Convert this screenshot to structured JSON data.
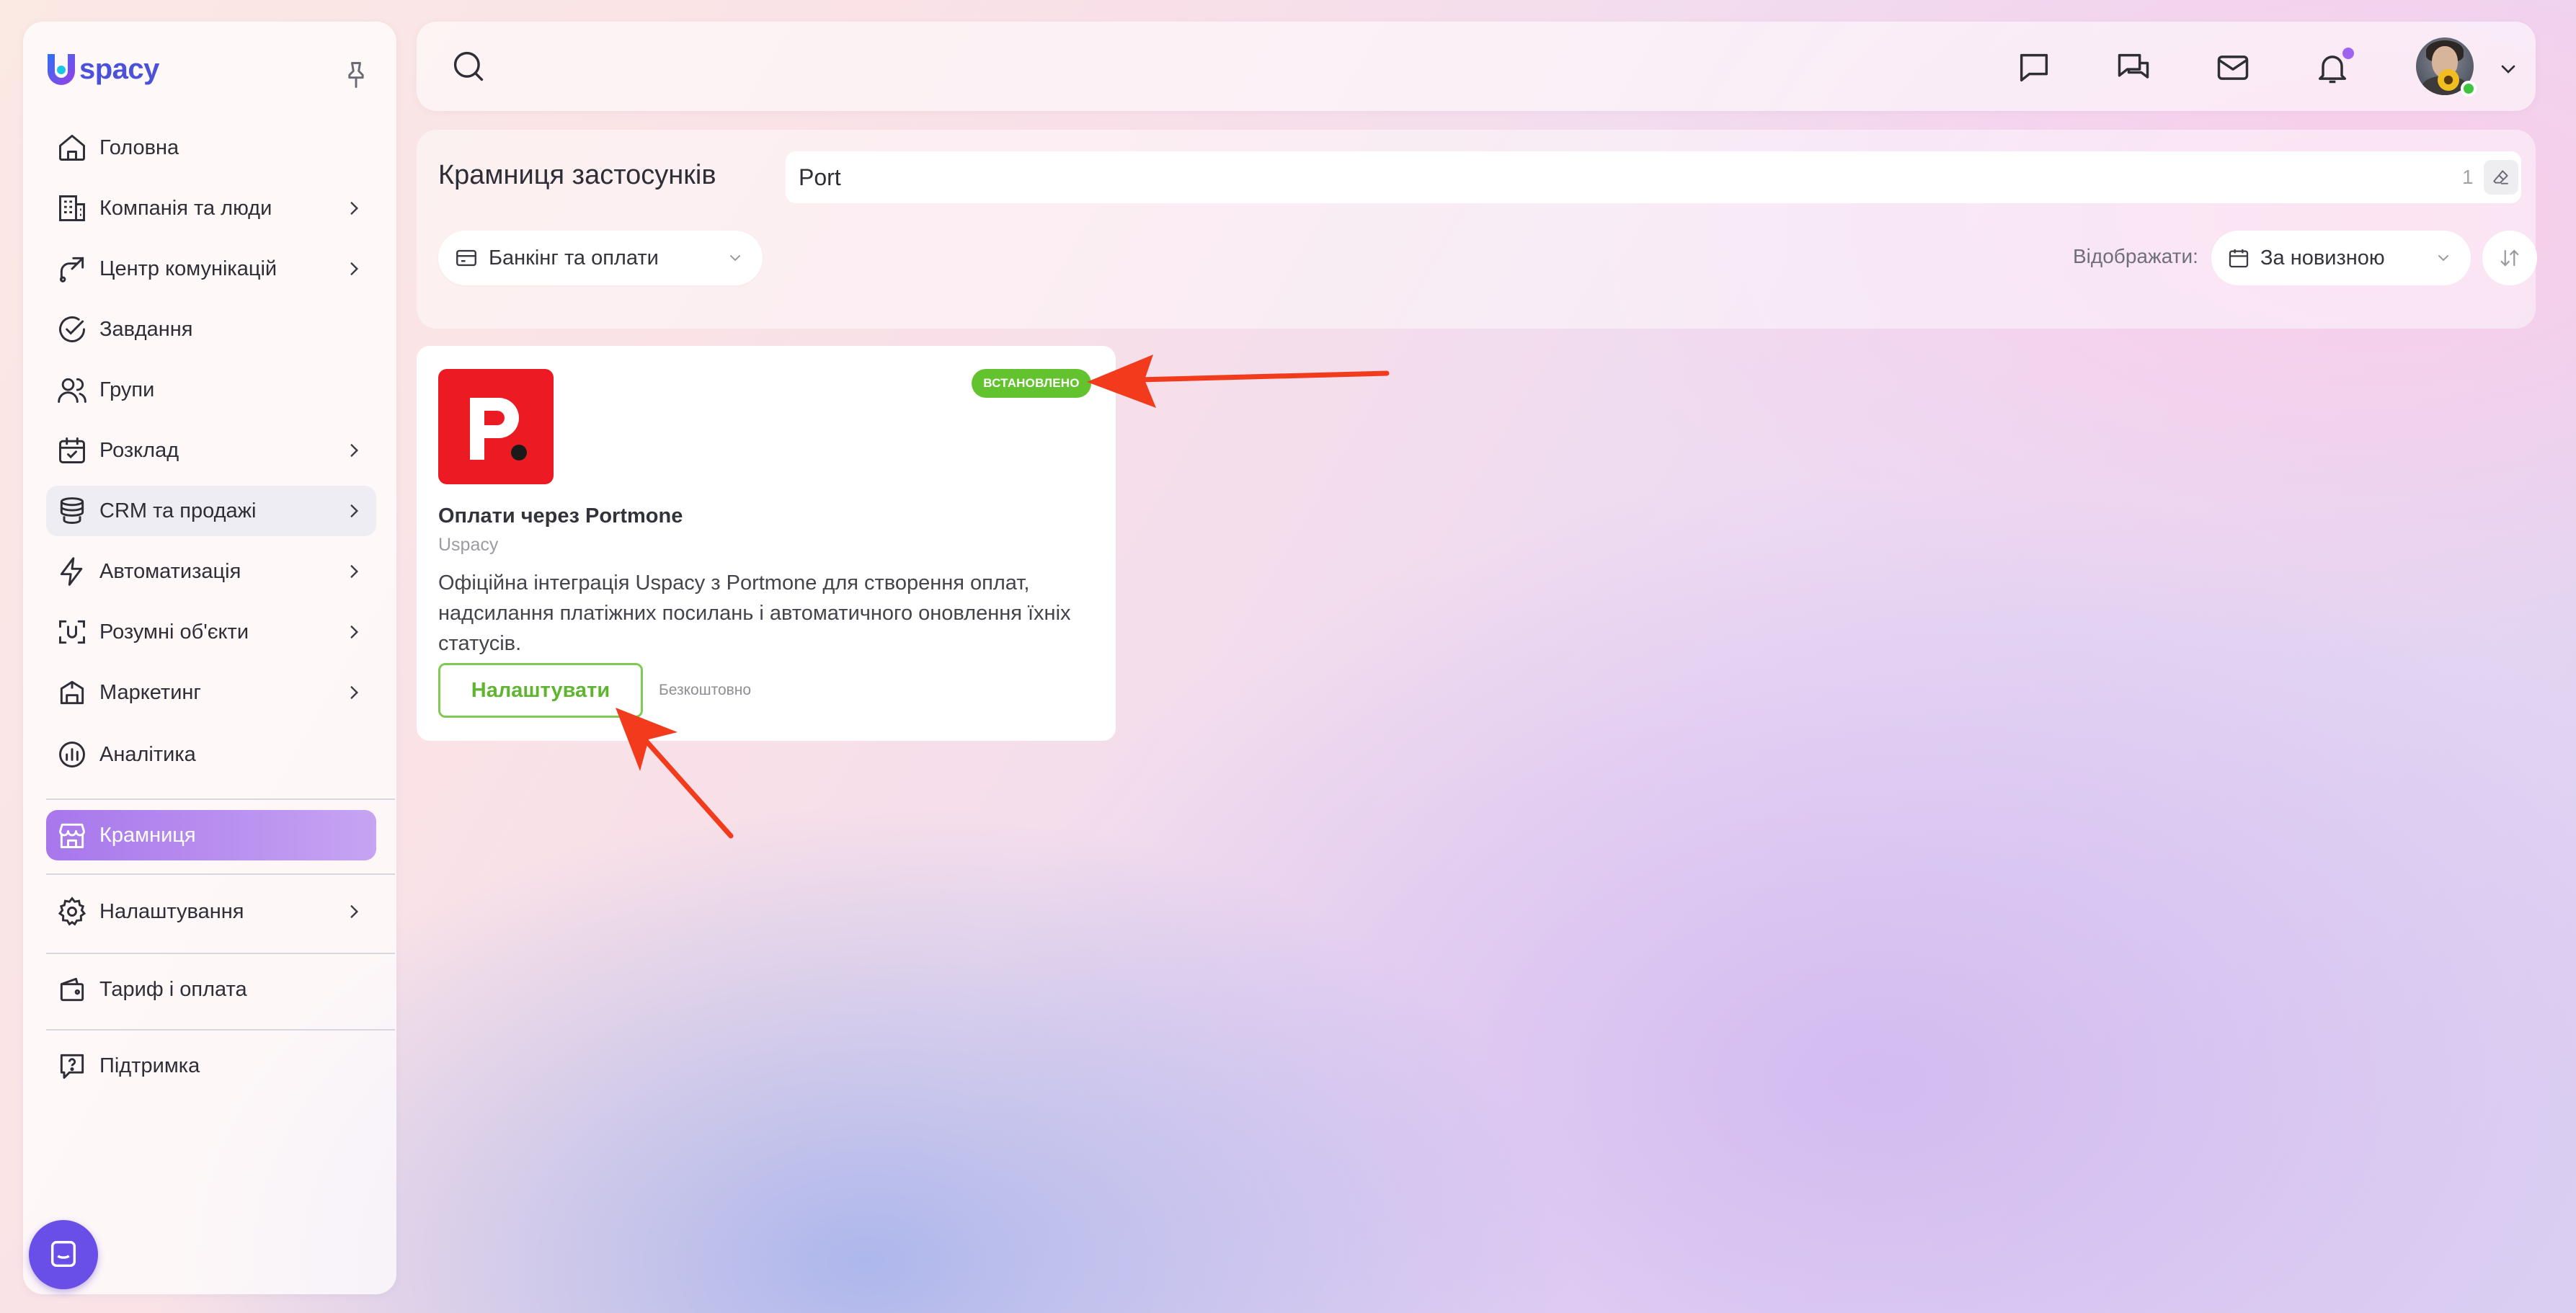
{
  "brand": {
    "name": "spacy",
    "accent": "#4a52d9"
  },
  "sidebar": {
    "items": [
      {
        "label": "Головна",
        "icon": "home-icon",
        "has_children": false
      },
      {
        "label": "Компанія та люди",
        "icon": "building-icon",
        "has_children": true
      },
      {
        "label": "Центр комунікацій",
        "icon": "communication-icon",
        "has_children": true
      },
      {
        "label": "Завдання",
        "icon": "check-circle-icon",
        "has_children": false
      },
      {
        "label": "Групи",
        "icon": "users-icon",
        "has_children": false
      },
      {
        "label": "Розклад",
        "icon": "calendar-icon",
        "has_children": true
      },
      {
        "label": "CRM та продажі",
        "icon": "coins-icon",
        "has_children": true
      },
      {
        "label": "Автоматизація",
        "icon": "lightning-icon",
        "has_children": true
      },
      {
        "label": "Розумні об'єкти",
        "icon": "scan-object-icon",
        "has_children": true
      },
      {
        "label": "Маркетинг",
        "icon": "megaphone-icon",
        "has_children": true
      },
      {
        "label": "Аналітика",
        "icon": "analytics-icon",
        "has_children": false
      },
      {
        "label": "Крамниця",
        "icon": "store-icon",
        "has_children": false,
        "active": true
      },
      {
        "label": "Налаштування",
        "icon": "gear-icon",
        "has_children": true
      },
      {
        "label": "Тариф і оплата",
        "icon": "wallet-icon",
        "has_children": false
      },
      {
        "label": "Підтримка",
        "icon": "help-chat-icon",
        "has_children": false
      }
    ],
    "active_color": "#a777ec"
  },
  "store": {
    "title": "Крамниця застосунків",
    "search": {
      "value": "Port",
      "count": "1"
    },
    "category": {
      "selected": "Банкінг та оплати"
    },
    "sort": {
      "label": "Відображати:",
      "selected": "За новизною"
    }
  },
  "app_card": {
    "badge": "ВСТАНОВЛЕНО",
    "badge_color": "#62c32e",
    "name": "Оплати через Portmone",
    "vendor": "Uspacy",
    "description": "Офіційна інтеграція Uspacy з Portmone для створення оплат, надсилання платіжних посилань і автоматичного оновлення їхніх статусів.",
    "button_label": "Налаштувати",
    "price": "Безкоштовно",
    "logo_color": "#ec1b23"
  },
  "annotations": {
    "arrow_color": "#f23b1c"
  }
}
